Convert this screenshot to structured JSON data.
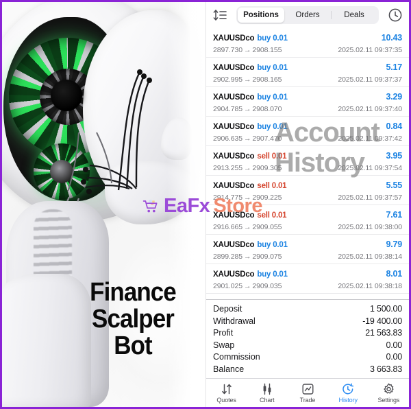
{
  "promo": {
    "title_lines": [
      "Finance",
      "Scalper",
      "Bot"
    ],
    "watermark_account": "Account",
    "watermark_history": "History",
    "store_brand_a": "EaFx",
    "store_brand_b": "Store",
    "cart_icon": "shopping-cart-icon"
  },
  "app": {
    "topbar": {
      "sort_icon": "sort-icon",
      "clock_icon": "clock-icon",
      "tabs": [
        {
          "label": "Positions",
          "active": true
        },
        {
          "label": "Orders",
          "active": false
        },
        {
          "label": "Deals",
          "active": false
        }
      ]
    },
    "positions": [
      {
        "symbol": "XAUUSDco",
        "side": "buy",
        "volume": "0.01",
        "profit": "10.43",
        "open_price": "2897.730",
        "close_price": "2908.155",
        "time": "2025.02.11 09:37:35"
      },
      {
        "symbol": "XAUUSDco",
        "side": "buy",
        "volume": "0.01",
        "profit": "5.17",
        "open_price": "2902.995",
        "close_price": "2908.165",
        "time": "2025.02.11 09:37:37"
      },
      {
        "symbol": "XAUUSDco",
        "side": "buy",
        "volume": "0.01",
        "profit": "3.29",
        "open_price": "2904.785",
        "close_price": "2908.070",
        "time": "2025.02.11 09:37:40"
      },
      {
        "symbol": "XAUUSDco",
        "side": "buy",
        "volume": "0.01",
        "profit": "0.84",
        "open_price": "2906.635",
        "close_price": "2907.470",
        "time": "2025.02.11 09:37:42"
      },
      {
        "symbol": "XAUUSDco",
        "side": "sell",
        "volume": "0.01",
        "profit": "3.95",
        "open_price": "2913.255",
        "close_price": "2909.305",
        "time": "2025.02.11 09:37:54"
      },
      {
        "symbol": "XAUUSDco",
        "side": "sell",
        "volume": "0.01",
        "profit": "5.55",
        "open_price": "2914.775",
        "close_price": "2909.225",
        "time": "2025.02.11 09:37:57"
      },
      {
        "symbol": "XAUUSDco",
        "side": "sell",
        "volume": "0.01",
        "profit": "7.61",
        "open_price": "2916.665",
        "close_price": "2909.055",
        "time": "2025.02.11 09:38:00"
      },
      {
        "symbol": "XAUUSDco",
        "side": "buy",
        "volume": "0.01",
        "profit": "9.79",
        "open_price": "2899.285",
        "close_price": "2909.075",
        "time": "2025.02.11 09:38:14"
      },
      {
        "symbol": "XAUUSDco",
        "side": "buy",
        "volume": "0.01",
        "profit": "8.01",
        "open_price": "2901.025",
        "close_price": "2909.035",
        "time": "2025.02.11 09:38:18"
      }
    ],
    "arrow_glyph": "→",
    "summary": [
      {
        "label": "Deposit",
        "value": "1 500.00"
      },
      {
        "label": "Withdrawal",
        "value": "-19 400.00"
      },
      {
        "label": "Profit",
        "value": "21 563.83"
      },
      {
        "label": "Swap",
        "value": "0.00"
      },
      {
        "label": "Commission",
        "value": "0.00"
      },
      {
        "label": "Balance",
        "value": "3 663.83"
      }
    ],
    "tabbar": [
      {
        "label": "Quotes",
        "icon": "arrows-updown-icon",
        "active": false
      },
      {
        "label": "Chart",
        "icon": "candlestick-icon",
        "active": false
      },
      {
        "label": "Trade",
        "icon": "chart-box-icon",
        "active": false
      },
      {
        "label": "History",
        "icon": "history-clock-icon",
        "active": true
      },
      {
        "label": "Settings",
        "icon": "gear-icon",
        "active": false
      }
    ]
  },
  "colors": {
    "frame_border": "#8a23d6",
    "buy": "#1a82e2",
    "sell": "#d5452e",
    "accent": "#2a8bf2",
    "brand_purple": "#9b4bd8",
    "brand_orange": "#f08a6e"
  }
}
